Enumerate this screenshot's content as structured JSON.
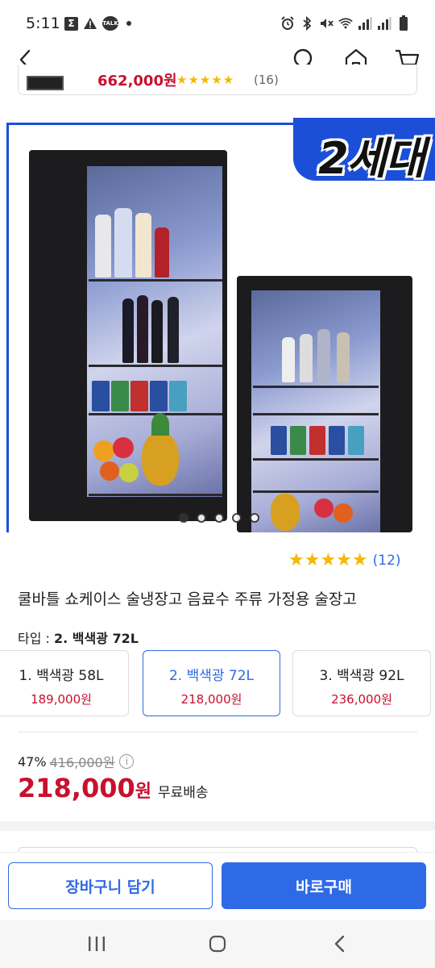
{
  "status_bar": {
    "time": "5:11",
    "notif_icons": [
      "sigma-icon",
      "warning-icon",
      "talk-icon",
      "dot"
    ],
    "talk_label": "TALK",
    "system_icons": [
      "alarm-icon",
      "bluetooth-icon",
      "mute-icon",
      "wifi-icon",
      "signal-icon",
      "signal-icon",
      "battery-icon"
    ]
  },
  "nav": {
    "back_icon": "back-arrow-icon",
    "search_icon": "search-icon",
    "home_icon": "home-icon",
    "cart_icon": "cart-icon"
  },
  "peek_card": {
    "price": "662,000원",
    "stars": "★★★★★",
    "review_count": "(16)"
  },
  "hero": {
    "badge": "2세대",
    "carousel_total": 5,
    "carousel_active": 1
  },
  "rating": {
    "stars": "★★★★★",
    "count": "(12)"
  },
  "product": {
    "title": "쿨바틀 쇼케이스 술냉장고 음료수 주류 가정용 술장고"
  },
  "type_selector": {
    "label": "타입 : ",
    "selected": "2. 백색광 72L",
    "options": [
      {
        "name": "1. 백색광 58L",
        "price": "189,000원"
      },
      {
        "name": "2. 백색광 72L",
        "price": "218,000원"
      },
      {
        "name": "3. 백색광 92L",
        "price": "236,000원"
      }
    ]
  },
  "pricing": {
    "discount_rate": "47%",
    "original_price": "416,000원",
    "sale_price": "218,000",
    "sale_unit": "원",
    "shipping": "무료배송"
  },
  "actions": {
    "add_to_cart": "장바구니 담기",
    "buy_now": "바로구매"
  },
  "colors": {
    "accent_blue": "#2f6ae6",
    "price_red": "#c8102e",
    "star_yellow": "#f5b700",
    "hero_blue": "#1c4fd8"
  }
}
